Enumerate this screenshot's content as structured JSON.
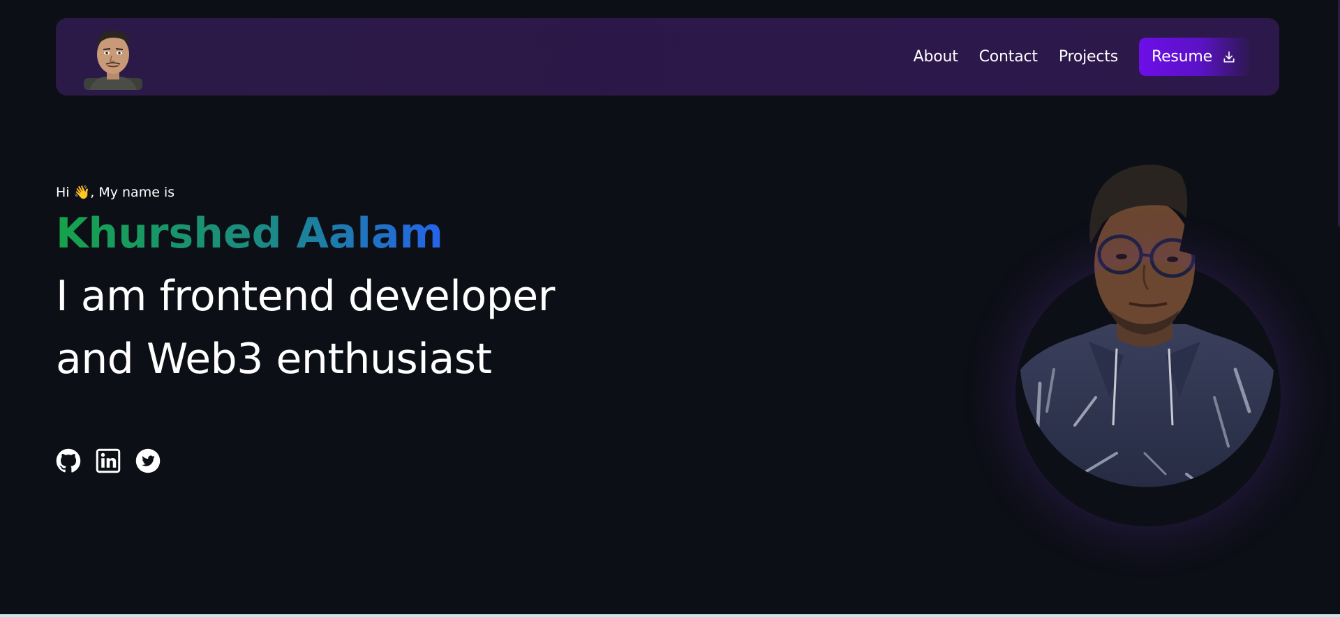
{
  "navbar": {
    "links": [
      "About",
      "Contact",
      "Projects"
    ],
    "resume_label": "Resume"
  },
  "hero": {
    "greeting": "Hi 👋, My name is",
    "name": "Khurshed Aalam",
    "line1": "I am frontend developer",
    "line2": "and Web3 enthusiast"
  },
  "socials": {
    "icons": [
      "github-icon",
      "linkedin-icon",
      "twitter-icon"
    ]
  },
  "colors": {
    "background": "#0d0f17",
    "navbar": "#2c1849",
    "resume_button": "#6d0ee8",
    "name_gradient_start": "#16a34a",
    "name_gradient_end": "#2563eb"
  }
}
